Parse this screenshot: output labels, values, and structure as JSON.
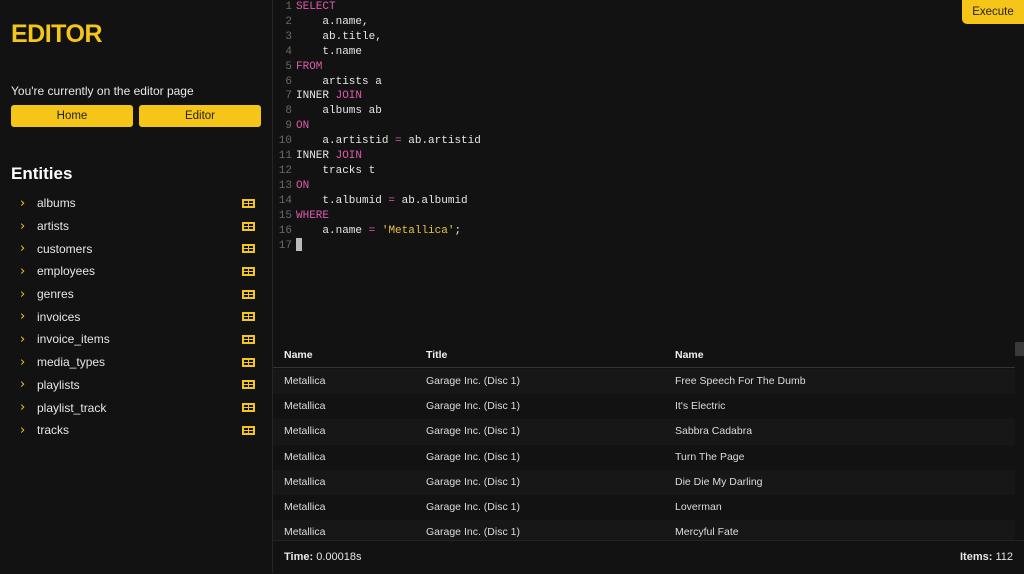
{
  "sidebar": {
    "brand": "EDITOR",
    "info": "You're currently on the editor page",
    "home_label": "Home",
    "editor_label": "Editor",
    "entities_title": "Entities",
    "entities": [
      "albums",
      "artists",
      "customers",
      "employees",
      "genres",
      "invoices",
      "invoice_items",
      "media_types",
      "playlists",
      "playlist_track",
      "tracks"
    ]
  },
  "editor": {
    "execute_label": "Execute",
    "lines": [
      [
        [
          "kw",
          "SELECT"
        ]
      ],
      [
        [
          "",
          "    a.name,"
        ]
      ],
      [
        [
          "",
          "    ab.title,"
        ]
      ],
      [
        [
          "",
          "    t.name"
        ]
      ],
      [
        [
          "kw",
          "FROM"
        ]
      ],
      [
        [
          "",
          "    artists a"
        ]
      ],
      [
        [
          "",
          "INNER "
        ],
        [
          "kw",
          "JOIN"
        ]
      ],
      [
        [
          "",
          "    albums ab"
        ]
      ],
      [
        [
          "kw",
          "ON"
        ]
      ],
      [
        [
          "",
          "    a.artistid "
        ],
        [
          "kw",
          "="
        ],
        [
          "",
          " ab.artistid"
        ]
      ],
      [
        [
          "",
          "INNER "
        ],
        [
          "kw",
          "JOIN"
        ]
      ],
      [
        [
          "",
          "    tracks t"
        ]
      ],
      [
        [
          "kw",
          "ON"
        ]
      ],
      [
        [
          "",
          "    t.albumid "
        ],
        [
          "kw",
          "="
        ],
        [
          "",
          " ab.albumid"
        ]
      ],
      [
        [
          "kw",
          "WHERE"
        ]
      ],
      [
        [
          "",
          "    a.name "
        ],
        [
          "kw",
          "="
        ],
        [
          "",
          " "
        ],
        [
          "str",
          "'Metallica'"
        ],
        [
          "",
          ";"
        ]
      ],
      [
        [
          "cursor",
          ""
        ]
      ]
    ]
  },
  "results": {
    "headers": [
      "Name",
      "Title",
      "Name"
    ],
    "rows": [
      [
        "Metallica",
        "Garage Inc. (Disc 1)",
        "Free Speech For The Dumb"
      ],
      [
        "Metallica",
        "Garage Inc. (Disc 1)",
        "It's Electric"
      ],
      [
        "Metallica",
        "Garage Inc. (Disc 1)",
        "Sabbra Cadabra"
      ],
      [
        "Metallica",
        "Garage Inc. (Disc 1)",
        "Turn The Page"
      ],
      [
        "Metallica",
        "Garage Inc. (Disc 1)",
        "Die Die My Darling"
      ],
      [
        "Metallica",
        "Garage Inc. (Disc 1)",
        "Loverman"
      ],
      [
        "Metallica",
        "Garage Inc. (Disc 1)",
        "Mercyful Fate"
      ]
    ]
  },
  "footer": {
    "time_label": "Time:",
    "time_value": "0.00018s",
    "items_label": "Items:",
    "items_value": "112"
  }
}
